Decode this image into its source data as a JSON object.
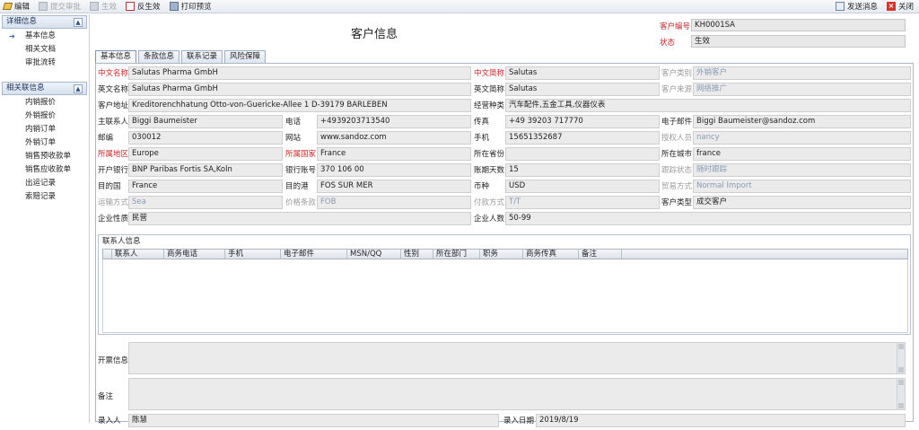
{
  "toolbar": {
    "edit": "编辑",
    "submit": "提交审批",
    "activate": "生效",
    "deactivate": "反生效",
    "print_preview": "打印预览",
    "send_message": "发送消息",
    "close": "关闭"
  },
  "sidebar": {
    "section1_title": "详细信息",
    "section1_items": [
      "基本信息",
      "相关文档",
      "审批流转"
    ],
    "section2_title": "相关联信息",
    "section2_items": [
      "内销报价",
      "外销报价",
      "内销订单",
      "外销订单",
      "销售预收款单",
      "销售应收款单",
      "出运记录",
      "索赔记录"
    ],
    "toggle_symbol": "▲"
  },
  "header": {
    "title": "客户信息",
    "customer_no_label": "客户编号",
    "customer_no": "KH0001SA",
    "status_label": "状态",
    "status": "生效"
  },
  "tabs": [
    "基本信息",
    "条款信息",
    "联系记录",
    "风险保障"
  ],
  "form": {
    "cn_name_label": "中文名称",
    "cn_name": "Salutas Pharma GmbH",
    "cn_short_label": "中文简称",
    "cn_short": "Salutas",
    "cust_category_label": "客户类别",
    "cust_category": "外销客户",
    "en_name_label": "英文名称",
    "en_name": "Salutas Pharma GmbH",
    "en_short_label": "英文简称",
    "en_short": "Salutas",
    "cust_source_label": "客户来源",
    "cust_source": "网络推广",
    "address_label": "客户地址",
    "address": "Kreditorenchhatung Otto-von-Guericke-Allee 1 D-39179 BARLEBEN",
    "business_label": "经营种类",
    "business": "汽车配件,五金工具,仪器仪表",
    "contact_label": "主联系人",
    "contact": "Biggi Baumeister",
    "phone_label": "电话",
    "phone": "+4939203713540",
    "fax_label": "传真",
    "fax": "+49 39203 717770",
    "email_label": "电子邮件",
    "email": "Biggi Baumeister@sandoz.com",
    "postcode_label": "邮编",
    "postcode": "030012",
    "website_label": "网站",
    "website": "www.sandoz.com",
    "mobile_label": "手机",
    "mobile": "15651352687",
    "auth_label": "授权人员",
    "auth": "nancy",
    "region_label": "所属地区",
    "region": "Europe",
    "country_label": "所属国家",
    "country": "France",
    "province_label": "所在省份",
    "province": "",
    "city_label": "所在城市",
    "city": "france",
    "bank_label": "开户银行",
    "bank": "BNP Paribas Fortis SA,Koln",
    "account_label": "银行账号",
    "account": "370 106 00",
    "days_label": "账期天数",
    "days": "15",
    "follow_label": "跟踪状态",
    "follow": "随时跟踪",
    "dest_label": "目的国",
    "dest": "France",
    "port_label": "目的港",
    "port": "FOS SUR MER",
    "currency_label": "币种",
    "currency": "USD",
    "trade_label": "贸易方式",
    "trade": "Normal Import",
    "transport_label": "运输方式",
    "transport": "Sea",
    "price_label": "价格条款",
    "price": "FOB",
    "payment_label": "付款方式",
    "payment": "T/T",
    "cust_type_label": "客户类型",
    "cust_type": "成交客户",
    "nature_label": "企业性质",
    "nature": "民营",
    "staff_label": "企业人数",
    "staff": "50-99"
  },
  "contacts": {
    "caption": "联系人信息",
    "columns": [
      "联系人",
      "商务电话",
      "手机",
      "电子邮件",
      "MSN/QQ",
      "性别",
      "所在部门",
      "职务",
      "商务传真",
      "备注"
    ]
  },
  "footer": {
    "invoice_label": "开票信息",
    "remark_label": "备注",
    "entry_person_label": "录入人",
    "entry_person": "陈慧",
    "entry_date_label": "录入日期",
    "entry_date": "2019/8/19"
  }
}
